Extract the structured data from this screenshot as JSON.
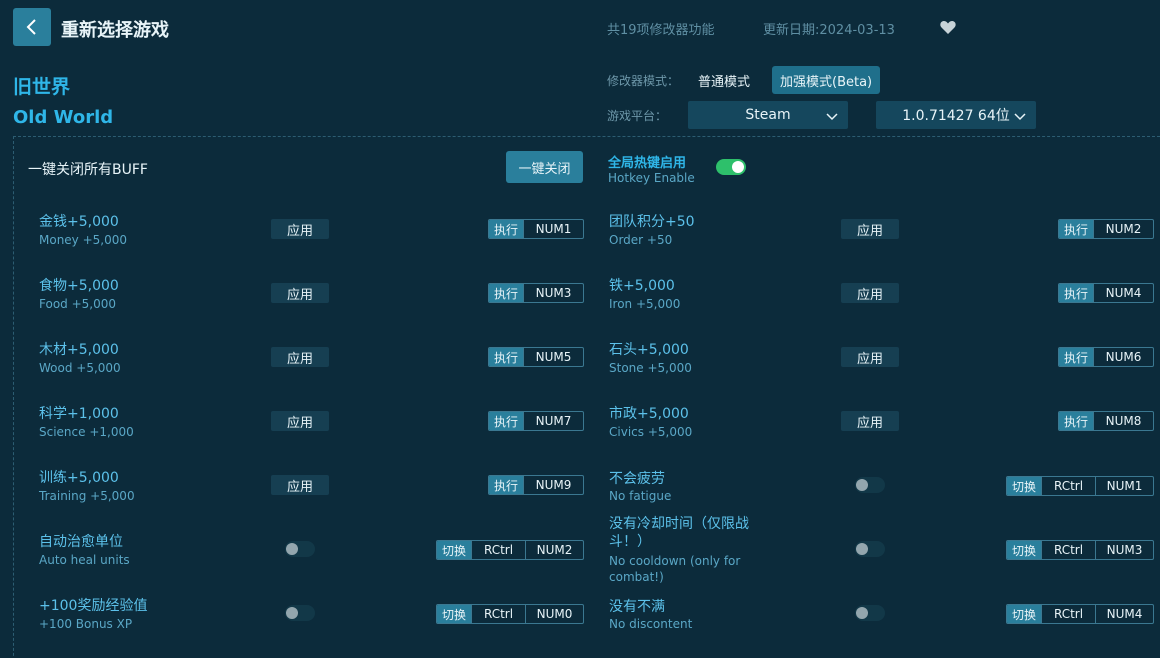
{
  "header": {
    "title": "重新选择游戏",
    "feature_count": "共19项修改器功能",
    "update_date": "更新日期:2024-03-13"
  },
  "game": {
    "name_cn": "旧世界",
    "name_en": "Old World"
  },
  "mode": {
    "label": "修改器模式：",
    "normal": "普通模式",
    "beta": "加强模式(Beta)"
  },
  "platform": {
    "label": "游戏平台：",
    "selected": "Steam",
    "version": "1.0.71427 64位"
  },
  "buff": {
    "label": "一键关闭所有BUFF",
    "close_button": "一键关闭"
  },
  "hotkey_toggle": {
    "label_cn": "全局热键启用",
    "label_en": "Hotkey Enable",
    "enabled": true
  },
  "labels": {
    "apply": "应用",
    "execute": "执行",
    "switch": "切换"
  },
  "items": [
    {
      "cn": "金钱+5,000",
      "en": "Money +5,000",
      "keys": [
        "NUM1"
      ]
    },
    {
      "cn": "团队积分+50",
      "en": "Order +50",
      "keys": [
        "NUM2"
      ]
    },
    {
      "cn": "食物+5,000",
      "en": "Food +5,000",
      "keys": [
        "NUM3"
      ]
    },
    {
      "cn": "铁+5,000",
      "en": "Iron +5,000",
      "keys": [
        "NUM4"
      ]
    },
    {
      "cn": "木材+5,000",
      "en": "Wood +5,000",
      "keys": [
        "NUM5"
      ]
    },
    {
      "cn": "石头+5,000",
      "en": "Stone +5,000",
      "keys": [
        "NUM6"
      ]
    },
    {
      "cn": "科学+1,000",
      "en": "Science +1,000",
      "keys": [
        "NUM7"
      ]
    },
    {
      "cn": "市政+5,000",
      "en": "Civics +5,000",
      "keys": [
        "NUM8"
      ]
    },
    {
      "cn": "训练+5,000",
      "en": "Training +5,000",
      "keys": [
        "NUM9"
      ]
    },
    {
      "cn": "不会疲劳",
      "en": "No fatigue",
      "keys": [
        "RCtrl",
        "NUM1"
      ]
    },
    {
      "cn": "自动治愈单位",
      "en": "Auto heal units",
      "keys": [
        "RCtrl",
        "NUM2"
      ]
    },
    {
      "cn": "没有冷却时间（仅限战斗！）",
      "en": "No cooldown (only for combat!)",
      "keys": [
        "RCtrl",
        "NUM3"
      ]
    },
    {
      "cn": "+100奖励经验值",
      "en": "+100 Bonus XP",
      "keys": [
        "RCtrl",
        "NUM0"
      ]
    },
    {
      "cn": "没有不满",
      "en": "No discontent",
      "keys": [
        "RCtrl",
        "NUM4"
      ]
    }
  ]
}
